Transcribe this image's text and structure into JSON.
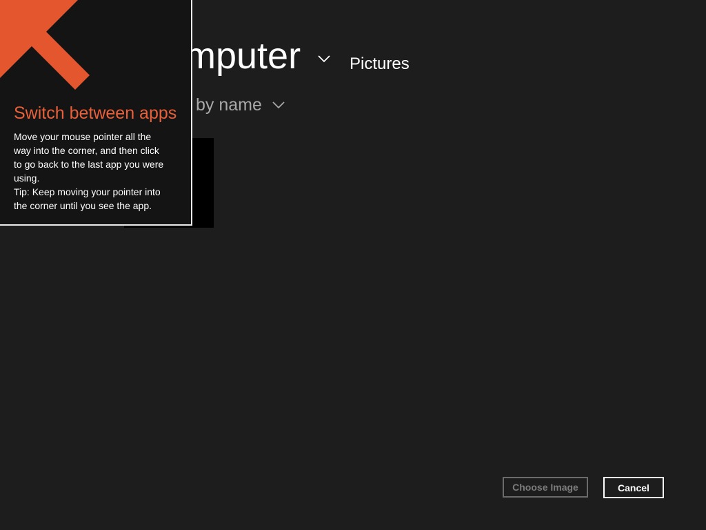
{
  "picker": {
    "location_title": "mputer",
    "location_breadcrumb": "Pictures",
    "sort_label": "by name"
  },
  "tip": {
    "title": "Switch between apps",
    "body_lines": [
      "Move your mouse pointer all the",
      "way into the corner, and then click",
      "to go back to the last app you were",
      "using.",
      "Tip: Keep moving your pointer into",
      "the corner until you see the app."
    ]
  },
  "buttons": {
    "choose_image": "Choose Image",
    "choose_image_state": "disabled",
    "cancel": "Cancel"
  },
  "icons": {
    "location_chevron": "chevron-down-icon",
    "sort_chevron": "chevron-down-icon",
    "tip_arrow": "arrow-up-left-icon"
  },
  "colors": {
    "bg": "#1d1d1d",
    "tip-bg": "#141414",
    "accent": "#e4572e",
    "tip-title": "#e8603a",
    "secondary": "#a8a8a8",
    "disabled": "#6b6b6b",
    "text": "#ffffff"
  }
}
